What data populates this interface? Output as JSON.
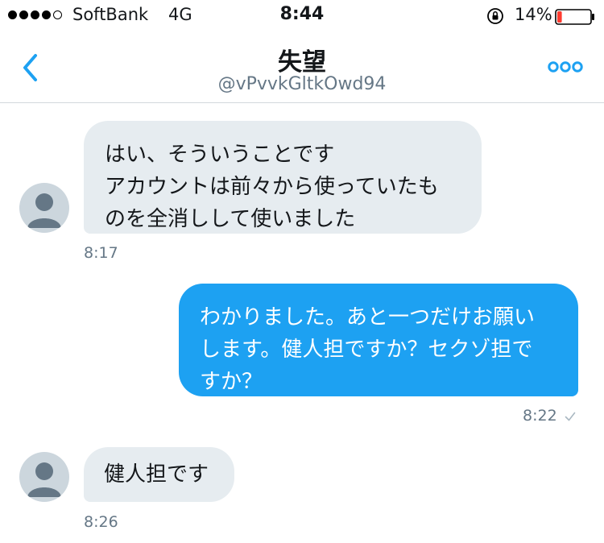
{
  "status_bar": {
    "carrier": "SoftBank",
    "network": "4G",
    "time": "8:44",
    "battery_percent": "14%",
    "battery_level": 0.14,
    "battery_color": "#ff3b30",
    "signal_bars_filled": 4
  },
  "header": {
    "title": "失望",
    "handle": "@vPvvkGltkOwd94",
    "back_icon": "chevron-left-icon",
    "more_icon": "more-dots-icon",
    "accent_color": "#1da1f2"
  },
  "messages": [
    {
      "direction": "incoming",
      "text": "はい、そういうことです\nアカウントは前々から使っていたも\nのを全消しして使いました",
      "time": "8:17"
    },
    {
      "direction": "outgoing",
      "text": "わかりました。あと一つだけお願い\nします。健人担ですか？セクゾ担で\nすか？",
      "time": "8:22",
      "status_icon": "sent-check-icon"
    },
    {
      "direction": "incoming",
      "text": "健人担です",
      "time": "8:26"
    }
  ]
}
